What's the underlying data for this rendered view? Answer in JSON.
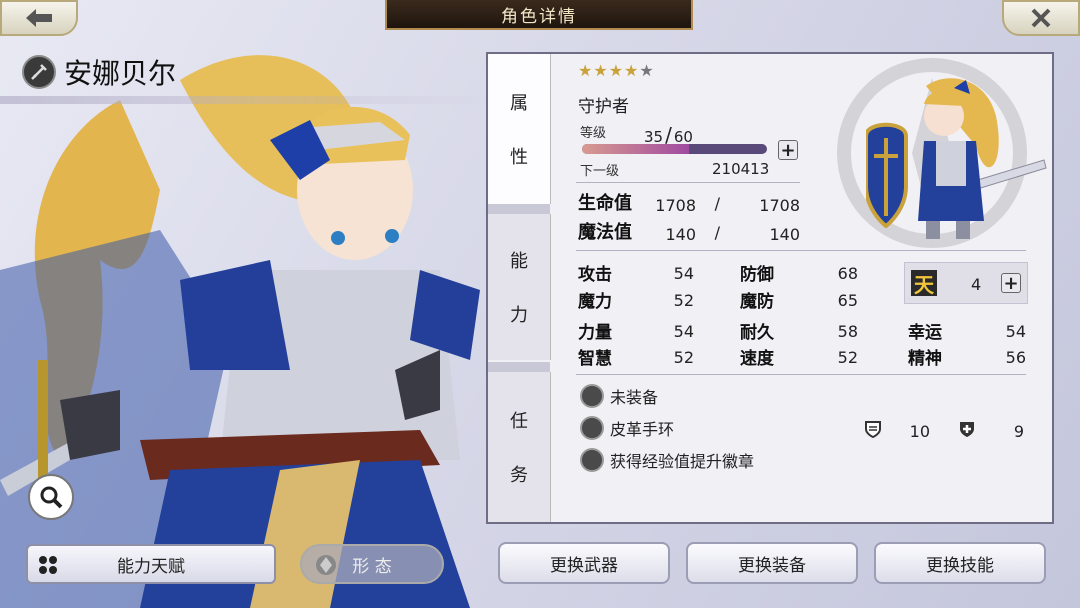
{
  "header": {
    "title": "角色详情"
  },
  "character": {
    "name": "安娜贝尔"
  },
  "tabs": {
    "attr": [
      "属",
      "性"
    ],
    "ability": [
      "能",
      "力"
    ],
    "quest": [
      "任",
      "务"
    ]
  },
  "profile": {
    "stars_filled": 4,
    "stars_total": 5,
    "role": "守护者",
    "level_label": "等级",
    "level": "35",
    "level_max": "60",
    "level_progress": 0.58,
    "next_label": "下一级",
    "next_exp": "210413"
  },
  "vitals": {
    "hp_label": "生命值",
    "hp": "1708",
    "hp_max": "1708",
    "mp_label": "魔法值",
    "mp": "140",
    "mp_max": "140"
  },
  "stats": {
    "atk_label": "攻击",
    "atk": "54",
    "def_label": "防御",
    "def": "68",
    "mag_label": "魔力",
    "mag": "52",
    "mdef_label": "魔防",
    "mdef": "65",
    "str_label": "力量",
    "str": "54",
    "end_label": "耐久",
    "end": "58",
    "luck_label": "幸运",
    "luck": "54",
    "int_label": "智慧",
    "int": "52",
    "spd_label": "速度",
    "spd": "52",
    "spi_label": "精神",
    "spi": "56",
    "talent_glyph": "天",
    "talent": "4"
  },
  "equipment": {
    "weapon": "未装备",
    "accessory": "皮革手环",
    "acc_def": "10",
    "acc_hp": "9",
    "badge": "获得经验值提升徽章"
  },
  "buttons": {
    "ability_talent": "能力天赋",
    "form": "形 态",
    "change_weapon": "更换武器",
    "change_equipment": "更换装备",
    "change_skill": "更换技能"
  },
  "colors": {
    "accent_gold": "#b08d4e",
    "title_bg": "#2a1d13",
    "armor_blue": "#1f3a8f",
    "hair_gold": "#e0b34a"
  }
}
